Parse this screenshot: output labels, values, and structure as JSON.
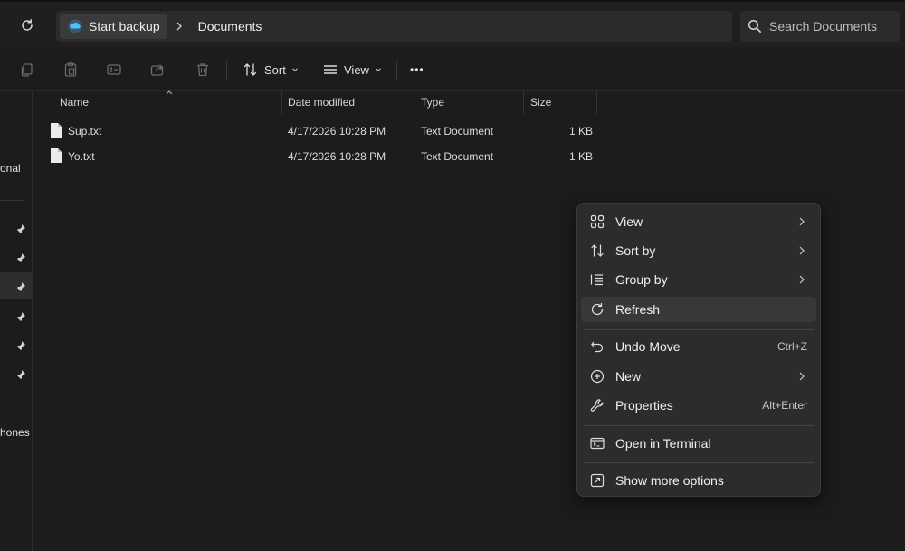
{
  "address_bar": {
    "breadcrumbs": [
      "Start backup",
      "Documents"
    ],
    "search_placeholder": "Search Documents"
  },
  "command_bar": {
    "sort_label": "Sort",
    "view_label": "View",
    "more_label": "•••"
  },
  "nav": {
    "partial_labels": [
      "onal",
      "hones"
    ]
  },
  "file_list": {
    "columns": [
      "Name",
      "Date modified",
      "Type",
      "Size"
    ],
    "rows": [
      {
        "name": "Sup.txt",
        "modified": "4/17/2026 10:28 PM",
        "type": "Text Document",
        "size": "1 KB"
      },
      {
        "name": "Yo.txt",
        "modified": "4/17/2026 10:28 PM",
        "type": "Text Document",
        "size": "1 KB"
      }
    ]
  },
  "context_menu": {
    "items": [
      {
        "label": "View",
        "icon": "grid-view-icon",
        "submenu": true
      },
      {
        "label": "Sort by",
        "icon": "sort-icon",
        "submenu": true
      },
      {
        "label": "Group by",
        "icon": "group-icon",
        "submenu": true
      },
      {
        "label": "Refresh",
        "icon": "refresh-icon"
      },
      {
        "label": "Undo Move",
        "icon": "undo-icon",
        "shortcut": "Ctrl+Z"
      },
      {
        "label": "New",
        "icon": "new-icon",
        "submenu": true
      },
      {
        "label": "Properties",
        "icon": "wrench-icon",
        "shortcut": "Alt+Enter"
      },
      {
        "label": "Open in Terminal",
        "icon": "terminal-icon"
      },
      {
        "label": "Show more options",
        "icon": "more-options-icon"
      }
    ]
  },
  "colors": {
    "background": "#1c1c1c",
    "menu_bg": "#2c2c2c",
    "accent_cloud": "#4cc2ff"
  }
}
